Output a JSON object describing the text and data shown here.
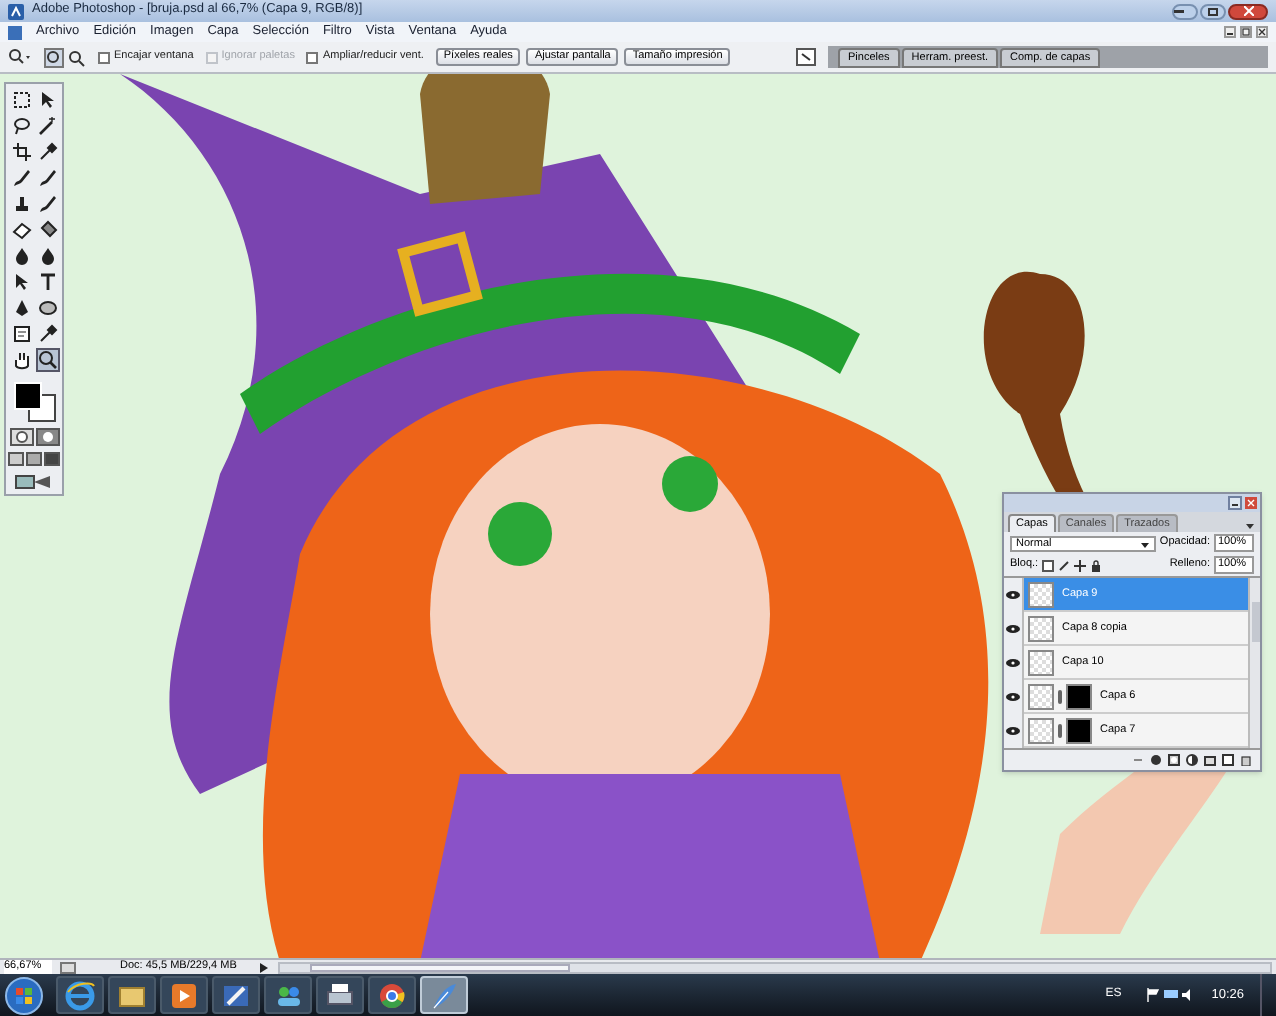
{
  "window": {
    "title": "Adobe Photoshop - [bruja.psd al 66,7% (Capa 9, RGB/8)]"
  },
  "menu": [
    "Archivo",
    "Edición",
    "Imagen",
    "Capa",
    "Selección",
    "Filtro",
    "Vista",
    "Ventana",
    "Ayuda"
  ],
  "options_bar": {
    "checkboxes": [
      {
        "label": "Encajar ventana",
        "checked": false,
        "disabled": false
      },
      {
        "label": "Ignorar paletas",
        "checked": false,
        "disabled": true
      },
      {
        "label": "Ampliar/reducir vent.",
        "checked": false,
        "disabled": false
      }
    ],
    "buttons": [
      "Píxeles reales",
      "Ajustar pantalla",
      "Tamaño impresión"
    ],
    "palette_well": [
      "Pinceles",
      "Herram. preest.",
      "Comp. de capas"
    ]
  },
  "toolbox": {
    "tools": [
      {
        "kind": "marquee",
        "selected": false
      },
      {
        "kind": "move",
        "selected": false
      },
      {
        "kind": "lasso",
        "selected": false
      },
      {
        "kind": "wand",
        "selected": false
      },
      {
        "kind": "crop",
        "selected": false
      },
      {
        "kind": "eyedrop",
        "selected": false
      },
      {
        "kind": "brush",
        "selected": false
      },
      {
        "kind": "brush",
        "selected": false
      },
      {
        "kind": "stamp",
        "selected": false
      },
      {
        "kind": "brush",
        "selected": false
      },
      {
        "kind": "eraser",
        "selected": false
      },
      {
        "kind": "bucket",
        "selected": false
      },
      {
        "kind": "drop",
        "selected": false
      },
      {
        "kind": "drop",
        "selected": false
      },
      {
        "kind": "move",
        "selected": false
      },
      {
        "kind": "type",
        "selected": false
      },
      {
        "kind": "pen",
        "selected": false
      },
      {
        "kind": "shape",
        "selected": false
      },
      {
        "kind": "note",
        "selected": false
      },
      {
        "kind": "eyedrop",
        "selected": false
      },
      {
        "kind": "hand",
        "selected": false
      },
      {
        "kind": "zoom",
        "selected": true
      }
    ]
  },
  "layers_panel": {
    "tabs": [
      {
        "label": "Capas",
        "selected": true
      },
      {
        "label": "Canales",
        "selected": false
      },
      {
        "label": "Trazados",
        "selected": false
      }
    ],
    "blend_mode": "Normal",
    "opacity_label": "Opacidad:",
    "opacity": "100%",
    "lock_label": "Bloq.:",
    "fill_label": "Relleno:",
    "fill": "100%",
    "layers": [
      {
        "name": "Capa 9",
        "selected": true,
        "visible": true,
        "has_mask": false
      },
      {
        "name": "Capa 8 copia",
        "selected": false,
        "visible": true,
        "has_mask": false
      },
      {
        "name": "Capa 10",
        "selected": false,
        "visible": true,
        "has_mask": false
      },
      {
        "name": "Capa 6",
        "selected": false,
        "visible": true,
        "has_mask": true
      },
      {
        "name": "Capa 7",
        "selected": false,
        "visible": true,
        "has_mask": true
      }
    ]
  },
  "status_bar": {
    "zoom": "66,67%",
    "doc_info": "Doc: 45,5 MB/229,4 MB"
  },
  "taskbar": {
    "apps": [
      {
        "kind": "browser",
        "selected": false
      },
      {
        "kind": "folder",
        "selected": false
      },
      {
        "kind": "media",
        "selected": false
      },
      {
        "kind": "paint",
        "selected": false
      },
      {
        "kind": "people",
        "selected": false
      },
      {
        "kind": "printer",
        "selected": false
      },
      {
        "kind": "chrome",
        "selected": false
      },
      {
        "kind": "feather",
        "selected": true
      }
    ],
    "language": "ES",
    "time": "10:26"
  }
}
